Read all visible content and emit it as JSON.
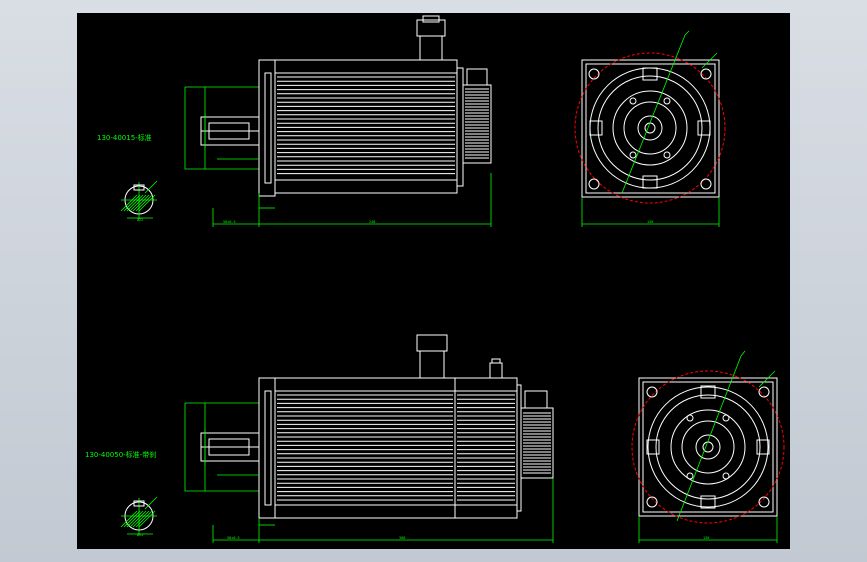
{
  "drawing": {
    "background": "#000000",
    "line_color": "#ffffff",
    "dimension_color": "#00ff00",
    "circle_color": "#ff0000",
    "icon": "cad-drawing-sheet"
  },
  "motors": [
    {
      "label": "130-40015-标准",
      "dims": {
        "shaft_len": "58±0.5",
        "body_len": "248",
        "flange_w": "130",
        "shaft_dia": "Ø22"
      }
    },
    {
      "label": "130-40050-标准-带刹",
      "dims": {
        "shaft_len": "58±0.5",
        "body_len": "308",
        "flange_w": "130",
        "shaft_dia": "Ø22"
      }
    }
  ]
}
